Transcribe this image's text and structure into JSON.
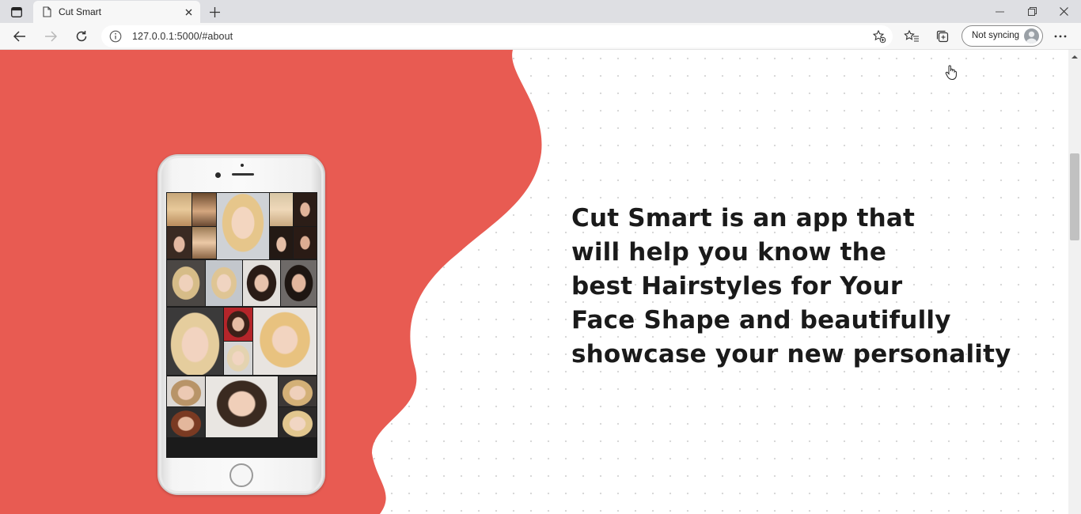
{
  "browser": {
    "tab_title": "Cut Smart",
    "url": "127.0.0.1:5000/#about",
    "profile_label": "Not syncing"
  },
  "about": {
    "lines": [
      "Cut Smart is an app that",
      "will help you know the",
      "best Hairstyles for Your",
      "Face Shape and beautifully",
      "showcase your new personality"
    ]
  },
  "colors": {
    "accent_red": "#e85b52",
    "headline": "#1a1a1a"
  },
  "icons": [
    "tab-actions-icon",
    "page-icon",
    "close-icon",
    "plus-icon",
    "minimize-icon",
    "restore-icon",
    "back-icon",
    "forward-icon",
    "refresh-icon",
    "info-icon",
    "favorite-add-icon",
    "favorites-icon",
    "collections-icon",
    "more-icon",
    "hand-cursor-icon"
  ]
}
